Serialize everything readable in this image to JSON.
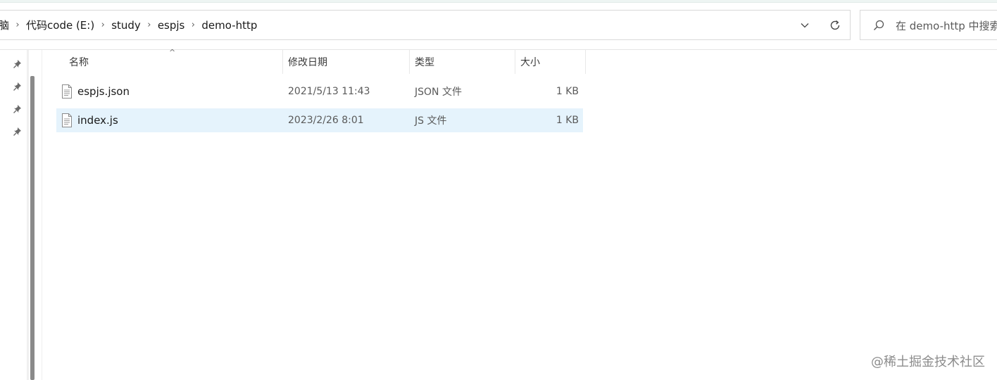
{
  "breadcrumbs": [
    "脑",
    "代码code (E:)",
    "study",
    "espjs",
    "demo-http"
  ],
  "search": {
    "placeholder": "在 demo-http 中搜索"
  },
  "columns": {
    "name": "名称",
    "modified": "修改日期",
    "type": "类型",
    "size": "大小"
  },
  "files": [
    {
      "name": "espjs.json",
      "modified": "2021/5/13 11:43",
      "type": "JSON 文件",
      "size": "1 KB",
      "selected": false
    },
    {
      "name": "index.js",
      "modified": "2023/2/26 8:01",
      "type": "JS 文件",
      "size": "1 KB",
      "selected": true
    }
  ],
  "icons": {
    "dropdown": "chevron-down-icon",
    "refresh": "refresh-icon",
    "search": "search-icon",
    "pin": "pin-icon",
    "file": "text-file-icon"
  },
  "colors": {
    "selection": "#e5f3fc",
    "border": "#d9d9d9"
  },
  "watermark": "@稀土掘金技术社区"
}
